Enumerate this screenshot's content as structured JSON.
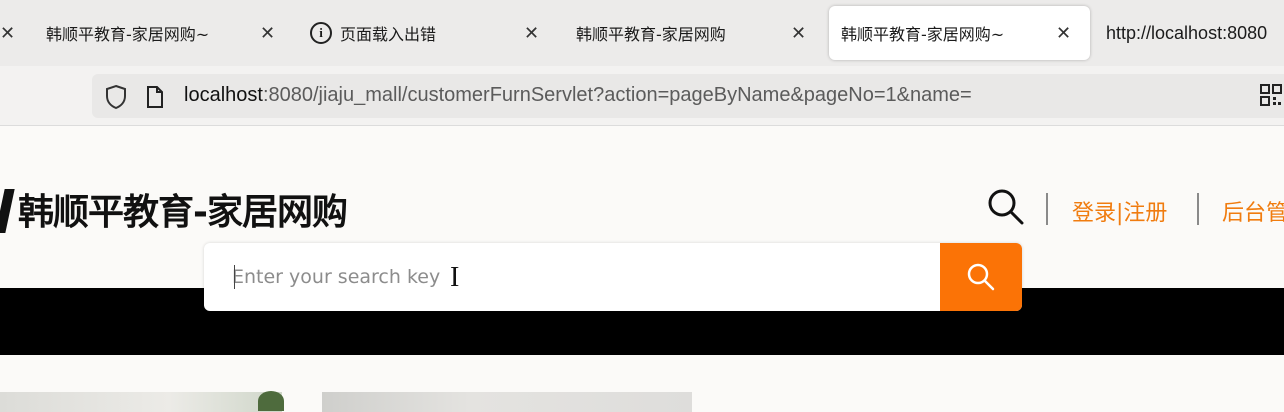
{
  "browser": {
    "tabs": [
      {
        "label": "韩顺平教育-家居网购~",
        "close": "✕"
      },
      {
        "label": "页面载入出错",
        "close": "✕"
      },
      {
        "label": "韩顺平教育-家居网购",
        "close": "✕"
      },
      {
        "label": "韩顺平教育-家居网购~",
        "close": "✕"
      },
      {
        "label": "http://localhost:8080"
      }
    ],
    "first_close": "✕",
    "url_host": "localhost",
    "url_rest": ":8080/jiaju_mall/customerFurnServlet?action=pageByName&pageNo=1&name="
  },
  "site": {
    "logo_text": "韩顺平教育-家居网购",
    "login_register": "登录|注册",
    "admin_link": "后台管",
    "search": {
      "placeholder": "Enter your search key",
      "value": ""
    }
  },
  "colors": {
    "accent": "#fb7306",
    "link": "#f07c0f"
  }
}
